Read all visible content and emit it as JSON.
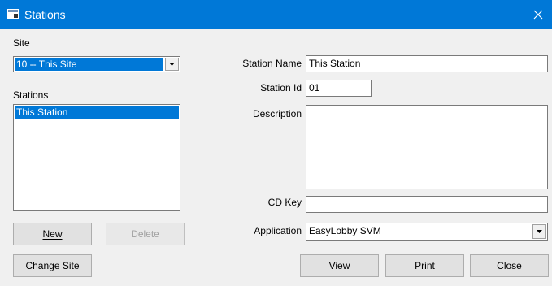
{
  "window": {
    "title": "Stations"
  },
  "site": {
    "label": "Site",
    "selected": "10 -- This Site"
  },
  "stations": {
    "label": "Stations",
    "items": [
      "This Station"
    ]
  },
  "form": {
    "station_name_label": "Station Name",
    "station_name_value": "This Station",
    "station_id_label": "Station Id",
    "station_id_value": "01",
    "description_label": "Description",
    "description_value": "",
    "cd_key_label": "CD Key",
    "cd_key_value": "",
    "application_label": "Application",
    "application_value": "EasyLobby SVM"
  },
  "buttons": {
    "new": "New",
    "delete": "Delete",
    "change_site": "Change Site",
    "view": "View",
    "print": "Print",
    "close": "Close"
  },
  "icons": {
    "app": "window-app-icon",
    "close": "close-icon",
    "dropdown": "chevron-down-icon"
  },
  "colors": {
    "titlebar": "#0078d7",
    "selection": "#0078d7",
    "window_bg": "#f0f0f0"
  }
}
